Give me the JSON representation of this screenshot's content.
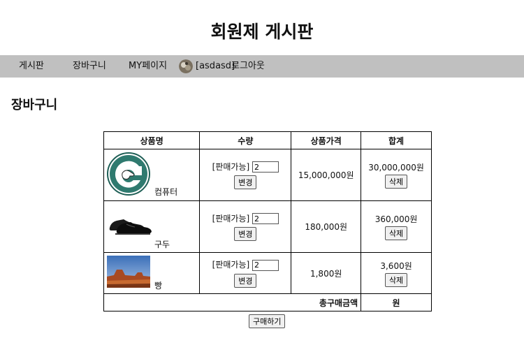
{
  "site": {
    "title": "회원제 게시판"
  },
  "nav": {
    "board": "게시판",
    "cart": "장바구니",
    "mypage": "MY페이지",
    "user": "[asdasd]",
    "logout": "로그아웃"
  },
  "page": {
    "section_title": "장바구니"
  },
  "table": {
    "headers": [
      "상품명",
      "수량",
      "상품가격",
      "합계"
    ],
    "items": [
      {
        "name": "컴퓨터",
        "image_icon": "computer-logo-icon",
        "qty_label": "[판매가능]",
        "qty": "2",
        "price": "15,000,000원",
        "sum": "30,000,000원"
      },
      {
        "name": "구두",
        "image_icon": "shoes-icon",
        "qty_label": "[판매가능]",
        "qty": "2",
        "price": "180,000원",
        "sum": "360,000원"
      },
      {
        "name": "빵",
        "image_icon": "desert-landscape-icon",
        "qty_label": "[판매가능]",
        "qty": "2",
        "price": "1,800원",
        "sum": "3,600원"
      }
    ],
    "change_label": "변경",
    "delete_label": "삭제",
    "total_label": "총구매금액",
    "total_value": "원"
  },
  "actions": {
    "buy_label": "구매하기"
  }
}
